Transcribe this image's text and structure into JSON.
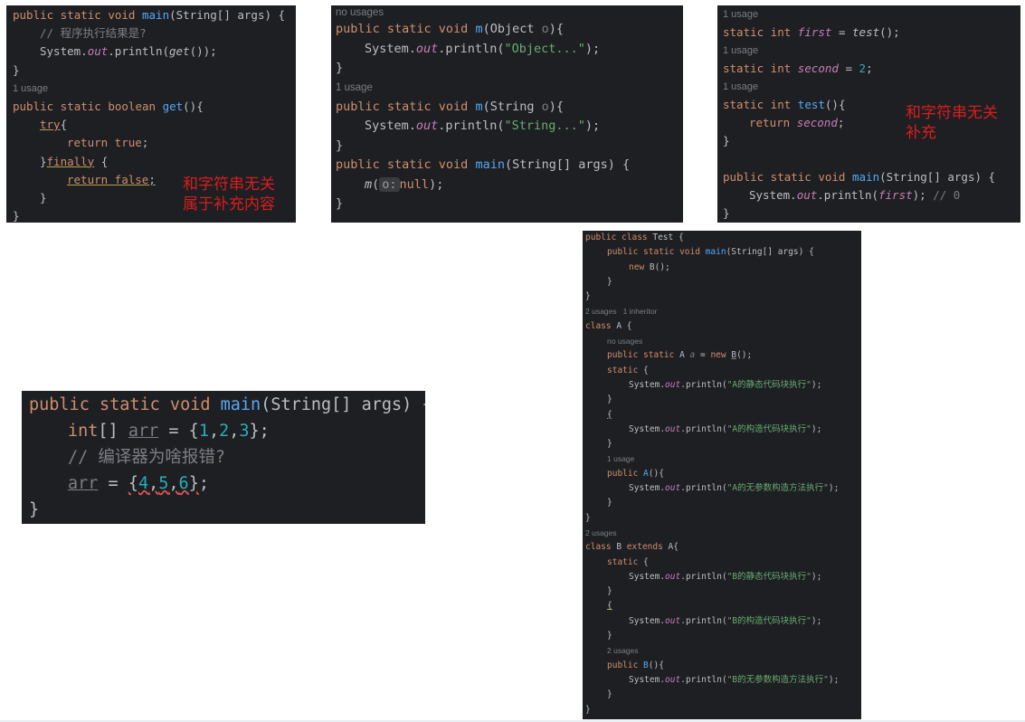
{
  "panel1": {
    "l1": {
      "a": "public static void ",
      "b": "main",
      "c": "(String[] args) {"
    },
    "l2": "// 程序执行结果是?",
    "l3": {
      "a": "System.",
      "b": "out",
      "c": ".println(",
      "d": "get",
      "e": "());"
    },
    "l4": "}",
    "usage": "1 usage",
    "l5": {
      "a": "public static boolean ",
      "b": "get",
      "c": "(){"
    },
    "l6": {
      "a": "try",
      "b": "{"
    },
    "l7": {
      "a": "return true",
      "b": ";"
    },
    "l8": {
      "a": "}",
      "b": "finally",
      "c": " {"
    },
    "l9": {
      "a": "return false",
      "b": ";"
    },
    "l10": "}",
    "l11": "}",
    "note1": "和字符串无关",
    "note2": "属于补充内容"
  },
  "panel2": {
    "hint": "no usages",
    "l1": {
      "a": "public static void ",
      "b": "m",
      "c": "(Object ",
      "d": "o",
      "e": "){"
    },
    "l2": {
      "a": "System.",
      "b": "out",
      "c": ".println(",
      "d": "\"Object...\"",
      "e": ");"
    },
    "l3": "}",
    "usage": "1 usage",
    "l4": {
      "a": "public static void ",
      "b": "m",
      "c": "(String ",
      "d": "o",
      "e": "){"
    },
    "l5": {
      "a": "System.",
      "b": "out",
      "c": ".println(",
      "d": "\"String...\"",
      "e": ");"
    },
    "l6": "}",
    "l7": {
      "a": "public static void ",
      "b": "main",
      "c": "(String[] args) {"
    },
    "l8": {
      "a": "m",
      "b": "(",
      "chip": "o:",
      "c": "null",
      "d": ");"
    },
    "l9": "}"
  },
  "panel3": {
    "u1": "1 usage",
    "l1": {
      "a": "static int ",
      "b": "first",
      "c": " = ",
      "d": "test",
      "e": "();"
    },
    "u2": "1 usage",
    "l2": {
      "a": "static int ",
      "b": "second",
      "c": " = ",
      "d": "2",
      "e": ";"
    },
    "u3": "1 usage",
    "l3": {
      "a": "static int ",
      "b": "test",
      "c": "(){"
    },
    "l4": {
      "a": "return ",
      "b": "second",
      "c": ";"
    },
    "l5": "}",
    "l6": {
      "a": "public static void ",
      "b": "main",
      "c": "(String[] args) {"
    },
    "l7": {
      "a": "System.",
      "b": "out",
      "c": ".println(",
      "d": "first",
      "e": "); ",
      "f": "// 0"
    },
    "l8": "}",
    "note1": "和字符串无关",
    "note2": "补充"
  },
  "panel4": {
    "l1": {
      "a": "public static void ",
      "b": "main",
      "c": "(String[] args) {"
    },
    "l2": {
      "a": "int",
      "b": "[] ",
      "c": "arr",
      "d": " = {",
      "e": "1",
      "f": ",",
      "g": "2",
      "h": ",",
      "i": "3",
      "j": "};"
    },
    "l3": "// 编译器为啥报错?",
    "l4": {
      "a": "arr",
      "b": " = ",
      "c": "{",
      "d": "4",
      "e": ",",
      "f": "5",
      "g": ",",
      "h": "6",
      "i": "}",
      "j": ";"
    },
    "l5": "}"
  },
  "panel5": {
    "l1": {
      "a": "public class ",
      "b": "Test {"
    },
    "l2": {
      "a": "public static void ",
      "b": "main",
      "c": "(String[] args) {"
    },
    "l3": {
      "a": "new ",
      "b": "B();"
    },
    "l4": "}",
    "l5": "}",
    "h1": "2 usages   1 inheritor",
    "l6": {
      "a": "class ",
      "b": "A {"
    },
    "h2": "no usages",
    "l7": {
      "a": "public static ",
      "b": "A ",
      "c": "a",
      "d": " = ",
      "e": "new ",
      "f": "B",
      "g": "();"
    },
    "l8": {
      "a": "static ",
      "b": "{"
    },
    "l9": {
      "a": "System.",
      "b": "out",
      "c": ".println(",
      "d": "\"A的静态代码块执行\"",
      "e": ");"
    },
    "l10": "}",
    "l11": "{",
    "l12": {
      "a": "System.",
      "b": "out",
      "c": ".println(",
      "d": "\"A的构造代码块执行\"",
      "e": ");"
    },
    "l13": "}",
    "h3": "1 usage",
    "l14": {
      "a": "public ",
      "b": "A",
      "c": "(){"
    },
    "l15": {
      "a": "System.",
      "b": "out",
      "c": ".println(",
      "d": "\"A的无参数构造方法执行\"",
      "e": ");"
    },
    "l16": "}",
    "l17": "}",
    "h4": "2 usages",
    "l18": {
      "a": "class ",
      "b": "B ",
      "c": "extends ",
      "d": "A{"
    },
    "l19": {
      "a": "static ",
      "b": "{"
    },
    "l20": {
      "a": "System.",
      "b": "out",
      "c": ".println(",
      "d": "\"B的静态代码块执行\"",
      "e": ");"
    },
    "l21": "}",
    "l22": "{",
    "l23": {
      "a": "System.",
      "b": "out",
      "c": ".println(",
      "d": "\"B的构造代码块执行\"",
      "e": ");"
    },
    "l24": "}",
    "h5": "2 usages",
    "l25": {
      "a": "public ",
      "b": "B",
      "c": "(){"
    },
    "l26": {
      "a": "System.",
      "b": "out",
      "c": ".println(",
      "d": "\"B的无参数构造方法执行\"",
      "e": ");"
    },
    "l27": "}",
    "l28": "}"
  }
}
